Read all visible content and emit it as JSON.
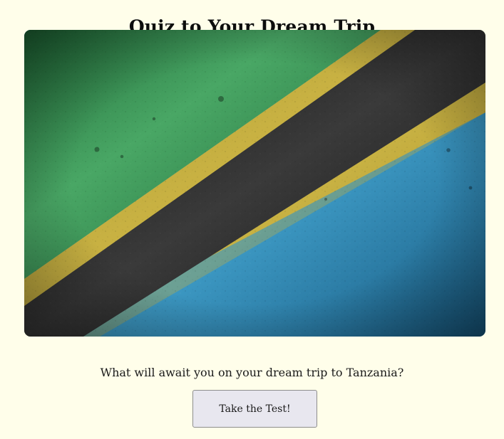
{
  "page": {
    "title": "Quiz to Your Dream Trip",
    "question": "What will await you on your dream trip to Tanzania?",
    "cta_label": "Take the Test!"
  },
  "hero": {
    "image": "tanzania-flag-grunge",
    "colors": {
      "green": "#2f8a4c",
      "gold": "#c6ad3b",
      "black": "#232323",
      "blue": "#2e8ab5"
    }
  },
  "colors": {
    "background": "#fffeea",
    "button_bg": "#e8e7ef",
    "button_border": "#8d8d8d"
  }
}
